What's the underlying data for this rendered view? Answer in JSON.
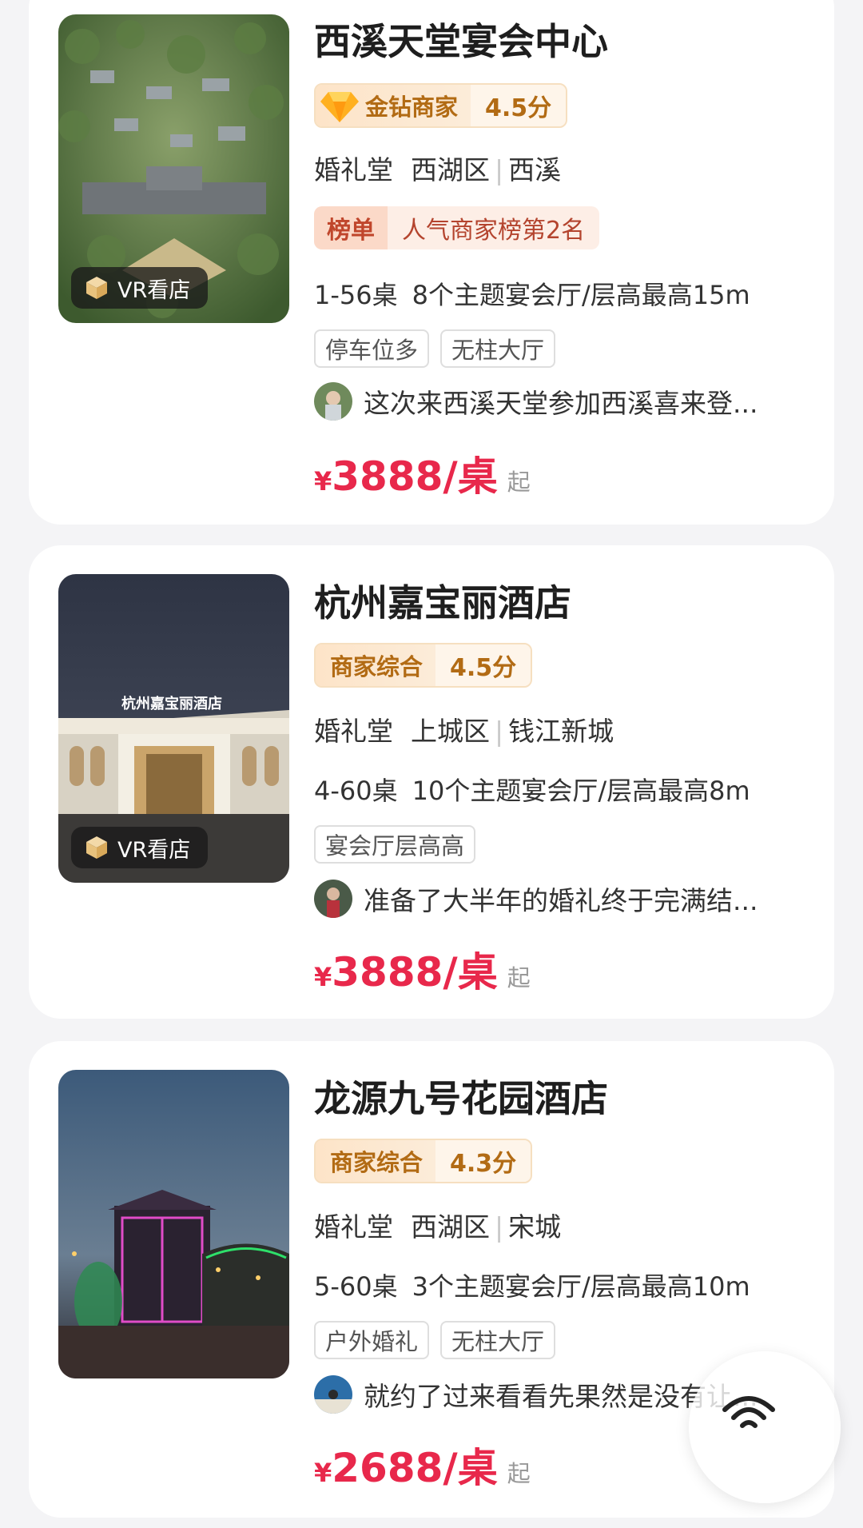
{
  "cards": [
    {
      "name": "西溪天堂宴会中心",
      "vr_label": "VR看店",
      "rating_label": "金钻商家",
      "rating_score": "4.5分",
      "category": "婚礼堂",
      "district": "西湖区",
      "area": "西溪",
      "rank_label": "榜单",
      "rank_text": "人气商家榜第2名",
      "tables": "1-56桌",
      "halls": "8个主题宴会厅/层高最高15m",
      "tags": [
        "停车位多",
        "无柱大厅"
      ],
      "review": "这次来西溪天堂参加西溪喜来登...",
      "price_symbol": "¥",
      "price": "3888/桌",
      "price_suffix": "起"
    },
    {
      "name": "杭州嘉宝丽酒店",
      "vr_label": "VR看店",
      "building_sign": "杭州嘉宝丽酒店",
      "rating_label": "商家综合",
      "rating_score": "4.5分",
      "category": "婚礼堂",
      "district": "上城区",
      "area": "钱江新城",
      "tables": "4-60桌",
      "halls": "10个主题宴会厅/层高最高8m",
      "tags": [
        "宴会厅层高高"
      ],
      "review": "准备了大半年的婚礼终于完满结...",
      "price_symbol": "¥",
      "price": "3888/桌",
      "price_suffix": "起"
    },
    {
      "name": "龙源九号花园酒店",
      "rating_label": "商家综合",
      "rating_score": "4.3分",
      "category": "婚礼堂",
      "district": "西湖区",
      "area": "宋城",
      "tables": "5-60桌",
      "halls": "3个主题宴会厅/层高最高10m",
      "tags": [
        "户外婚礼",
        "无柱大厅"
      ],
      "review": "就约了过来看看先果然是没有让...",
      "price_symbol": "¥",
      "price": "2688/桌",
      "price_suffix": "起"
    }
  ],
  "icons": {
    "vr": "vr-cube-icon",
    "gold_diamond": "diamond-icon",
    "floating": "wifi-signal-icon"
  },
  "colors": {
    "price": "#e8284b",
    "rating_text": "#b26b14",
    "rank_text": "#c0462c"
  }
}
